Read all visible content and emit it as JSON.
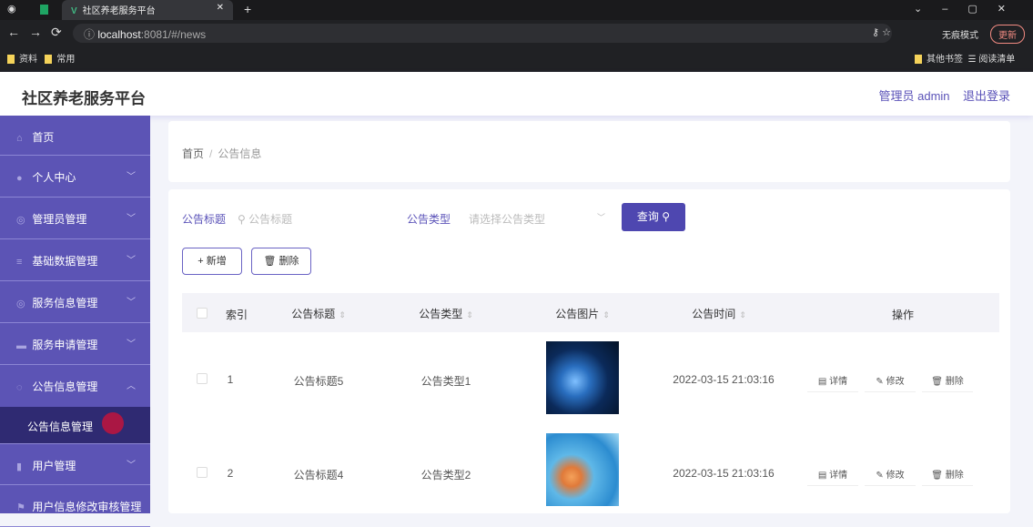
{
  "browser": {
    "tab_title": "社区养老服务平台",
    "url_host": "localhost",
    "url_path": ":8081/#/news",
    "incognito": "无痕模式",
    "update": "更新",
    "bookmarks": [
      "资料",
      "常用"
    ],
    "other_bookmarks": "其他书签",
    "reading_list": "阅读清单"
  },
  "header": {
    "title": "社区养老服务平台",
    "user": "管理员 admin",
    "logout": "退出登录"
  },
  "sidebar": {
    "items": [
      {
        "label": "首页",
        "icon": "home-icon"
      },
      {
        "label": "个人中心",
        "icon": "user-icon"
      },
      {
        "label": "管理员管理",
        "icon": "admin-icon"
      },
      {
        "label": "基础数据管理",
        "icon": "list-icon"
      },
      {
        "label": "服务信息管理",
        "icon": "service-icon"
      },
      {
        "label": "服务申请管理",
        "icon": "apply-icon"
      },
      {
        "label": "公告信息管理",
        "icon": "notice-icon"
      }
    ],
    "sub_item": "公告信息管理",
    "items2": [
      {
        "label": "用户管理"
      },
      {
        "label": "用户信息修改审核管理"
      }
    ]
  },
  "breadcrumb": {
    "home": "首页",
    "sep": "/",
    "current": "公告信息"
  },
  "search": {
    "title_label": "公告标题",
    "title_placeholder": "公告标题",
    "type_label": "公告类型",
    "type_placeholder": "请选择公告类型",
    "query": "查询"
  },
  "actions": {
    "add": "新增",
    "delete": "删除"
  },
  "table": {
    "headers": [
      "索引",
      "公告标题",
      "公告类型",
      "公告图片",
      "公告时间",
      "操作"
    ],
    "rows": [
      {
        "index": "1",
        "title": "公告标题5",
        "type": "公告类型1",
        "time": "2022-03-15 21:03:16"
      },
      {
        "index": "2",
        "title": "公告标题4",
        "type": "公告类型2",
        "time": "2022-03-15 21:03:16"
      }
    ],
    "row_actions": {
      "detail": "详情",
      "edit": "修改",
      "delete": "删除"
    }
  }
}
